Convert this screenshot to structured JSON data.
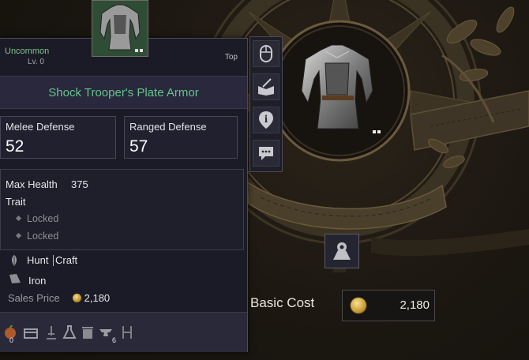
{
  "item": {
    "rarity": "Uncommon",
    "level": "Lv. 0",
    "slot": "Top",
    "name": "Shock Trooper's Plate Armor",
    "melee_defense_label": "Melee Defense",
    "melee_defense_value": "52",
    "ranged_defense_label": "Ranged Defense",
    "ranged_defense_value": "57",
    "max_health_label": "Max Health",
    "max_health_value": "375",
    "trait_label": "Trait",
    "traits": [
      "Locked",
      "Locked"
    ],
    "acquisition_hunt": "Hunt",
    "acquisition_craft": "Craft",
    "material": "Iron",
    "sales_price_label": "Sales Price",
    "sales_price_value": "2,180"
  },
  "footer_icons": [
    {
      "icon": "food-icon",
      "count": "0"
    },
    {
      "icon": "chest-icon",
      "count": ""
    },
    {
      "icon": "sword-in-ground-icon",
      "count": ""
    },
    {
      "icon": "flask-icon",
      "count": ""
    },
    {
      "icon": "trash-icon",
      "count": ""
    },
    {
      "icon": "anvil-icon",
      "count": "6"
    },
    {
      "icon": "tools-icon",
      "count": ""
    }
  ],
  "side_tabs": [
    "mouse-icon",
    "book-sword-icon",
    "info-icon",
    "chat-icon"
  ],
  "cost": {
    "label": "Basic Cost",
    "value": "2,180"
  },
  "colors": {
    "rarity_green": "#65c48d",
    "panel_bg": "#1b1b27",
    "gold": "#c79a34"
  }
}
